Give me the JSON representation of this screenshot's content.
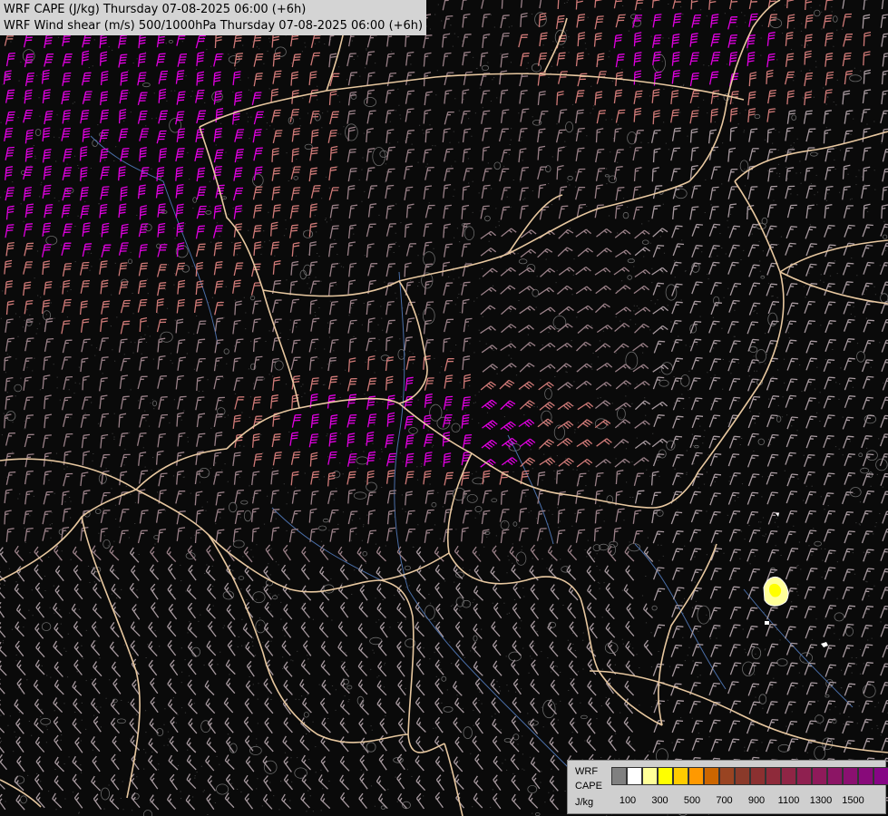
{
  "title": {
    "line1": "WRF CAPE (J/kg) Thursday 07-08-2025 06:00 (+6h)",
    "line2": "WRF Wind shear (m/s) 500/1000hPa Thursday 07-08-2025 06:00 (+6h)"
  },
  "legend": {
    "label_line1": "WRF",
    "label_line2": "CAPE",
    "label_line3": "J/kg",
    "swatch_colors": [
      "#808080",
      "#ffffff",
      "#ffff99",
      "#ffff00",
      "#ffcc00",
      "#ff9900",
      "#cc6600",
      "#994422",
      "#8a3a2a",
      "#8b3030",
      "#8e2a3a",
      "#8f2545",
      "#8f2050",
      "#8e1a5a",
      "#8c1565",
      "#8a1070",
      "#880a7a",
      "#860585"
    ],
    "ticks": [
      "100",
      "300",
      "500",
      "700",
      "900",
      "1100",
      "1300",
      "1500"
    ]
  },
  "colors": {
    "background": "#000000",
    "border": "#e8c8a0",
    "barb_low": "#a08890",
    "barb_mid": "#d08078",
    "barb_high": "#e000e0",
    "river": "#4a6ea8",
    "terrain": "#8a8a8a"
  }
}
